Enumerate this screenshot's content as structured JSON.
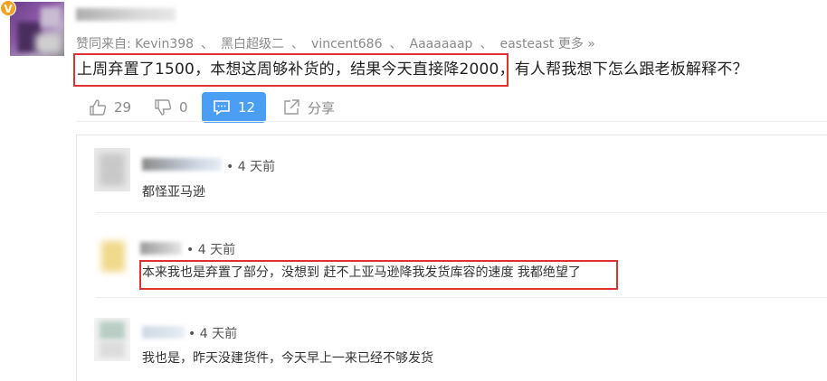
{
  "answer": {
    "vip_badge": "V",
    "likers_prefix": "赞同来自:",
    "likers": [
      "Kevin398",
      "黑白超级二",
      "vincent686",
      "Aaaaaaap",
      "easteast"
    ],
    "likers_separator": "、",
    "likers_more": "更多 »",
    "text": "上周弃置了1500，本想这周够补货的，结果今天直接降2000，有人帮我想下怎么跟老板解释不？",
    "highlight_color": "#e03131"
  },
  "actions": {
    "upvote_count": "29",
    "downvote_count": "0",
    "comment_count": "12",
    "share_label": "分享",
    "accent_color": "#4a9ff5"
  },
  "comments": [
    {
      "time": "• 4 天前",
      "text": "都怪亚马逊"
    },
    {
      "time": "• 4 天前",
      "text": "本来我也是弃置了部分，没想到 赶不上亚马逊降我发货库容的速度 我都绝望了"
    },
    {
      "time": "• 4 天前",
      "text": "我也是，昨天没建货件，今天早上一来已经不够发货"
    }
  ]
}
